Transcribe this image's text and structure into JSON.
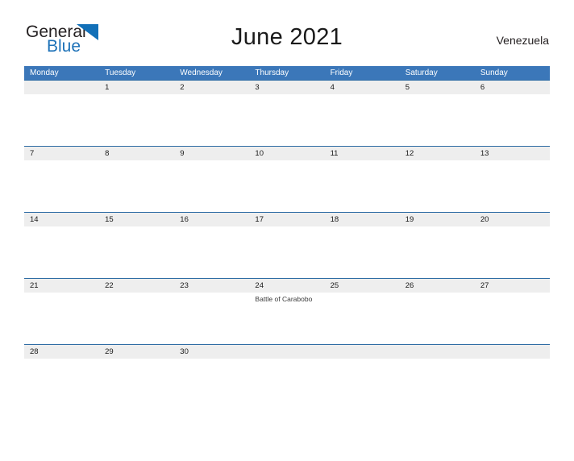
{
  "brand": {
    "name_top": "General",
    "name_bottom": "Blue",
    "triangle_color": "#1270b8",
    "text_color": "#231f20",
    "blue_text_color": "#1e72b8"
  },
  "header": {
    "title": "June 2021",
    "country": "Venezuela"
  },
  "theme": {
    "header_blue": "#3b77b9",
    "date_row_gray": "#eeeeee",
    "row_divider": "#2e6ca4"
  },
  "calendar": {
    "weekdays": [
      "Monday",
      "Tuesday",
      "Wednesday",
      "Thursday",
      "Friday",
      "Saturday",
      "Sunday"
    ],
    "weeks": [
      {
        "dates": [
          "",
          "1",
          "2",
          "3",
          "4",
          "5",
          "6"
        ],
        "events": [
          "",
          "",
          "",
          "",
          "",
          "",
          ""
        ]
      },
      {
        "dates": [
          "7",
          "8",
          "9",
          "10",
          "11",
          "12",
          "13"
        ],
        "events": [
          "",
          "",
          "",
          "",
          "",
          "",
          ""
        ]
      },
      {
        "dates": [
          "14",
          "15",
          "16",
          "17",
          "18",
          "19",
          "20"
        ],
        "events": [
          "",
          "",
          "",
          "",
          "",
          "",
          ""
        ]
      },
      {
        "dates": [
          "21",
          "22",
          "23",
          "24",
          "25",
          "26",
          "27"
        ],
        "events": [
          "",
          "",
          "",
          "Battle of Carabobo",
          "",
          "",
          ""
        ]
      },
      {
        "dates": [
          "28",
          "29",
          "30",
          "",
          "",
          "",
          ""
        ],
        "events": [
          "",
          "",
          "",
          "",
          "",
          "",
          ""
        ]
      }
    ]
  }
}
